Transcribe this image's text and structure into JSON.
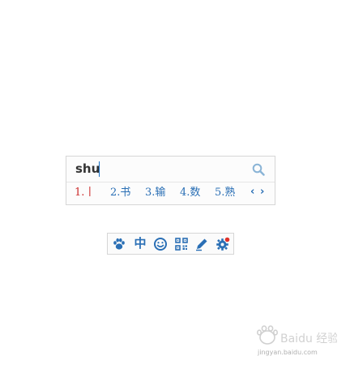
{
  "ime": {
    "pinyin": "shu",
    "candidates": [
      {
        "label": "1.丨"
      },
      {
        "label": "2.书"
      },
      {
        "label": "3.输"
      },
      {
        "label": "4.数"
      },
      {
        "label": "5.熟"
      }
    ],
    "prev_page": "‹",
    "next_page": "›"
  },
  "toolbar": {
    "mode_label": "中",
    "items": [
      "paw-icon",
      "mode-chinese",
      "smiley-icon",
      "qr-grid-icon",
      "pencil-icon",
      "gear-icon"
    ]
  },
  "colors": {
    "accent": "#2a6fb5",
    "first_candidate": "#cc2b2b",
    "notification_dot": "#e0322b"
  },
  "watermark": {
    "text": "Baidu 经验",
    "url": "jingyan.baidu.com"
  }
}
